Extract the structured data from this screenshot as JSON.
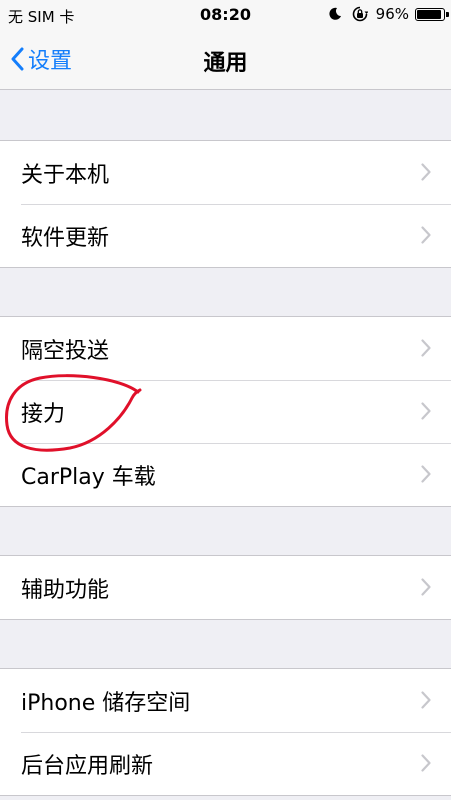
{
  "status_bar": {
    "carrier": "无 SIM 卡",
    "time": "08:20",
    "battery_percent": "96%",
    "battery_level": 0.96
  },
  "nav": {
    "back_label": "设置",
    "title": "通用"
  },
  "groups": [
    {
      "items": [
        "关于本机",
        "软件更新"
      ]
    },
    {
      "items": [
        "隔空投送",
        "接力",
        "CarPlay 车载"
      ]
    },
    {
      "items": [
        "辅助功能"
      ]
    },
    {
      "items": [
        "iPhone 储存空间",
        "后台应用刷新"
      ]
    }
  ],
  "colors": {
    "accent": "#147efb",
    "background": "#efeff4",
    "annotation": "#e0102a"
  }
}
